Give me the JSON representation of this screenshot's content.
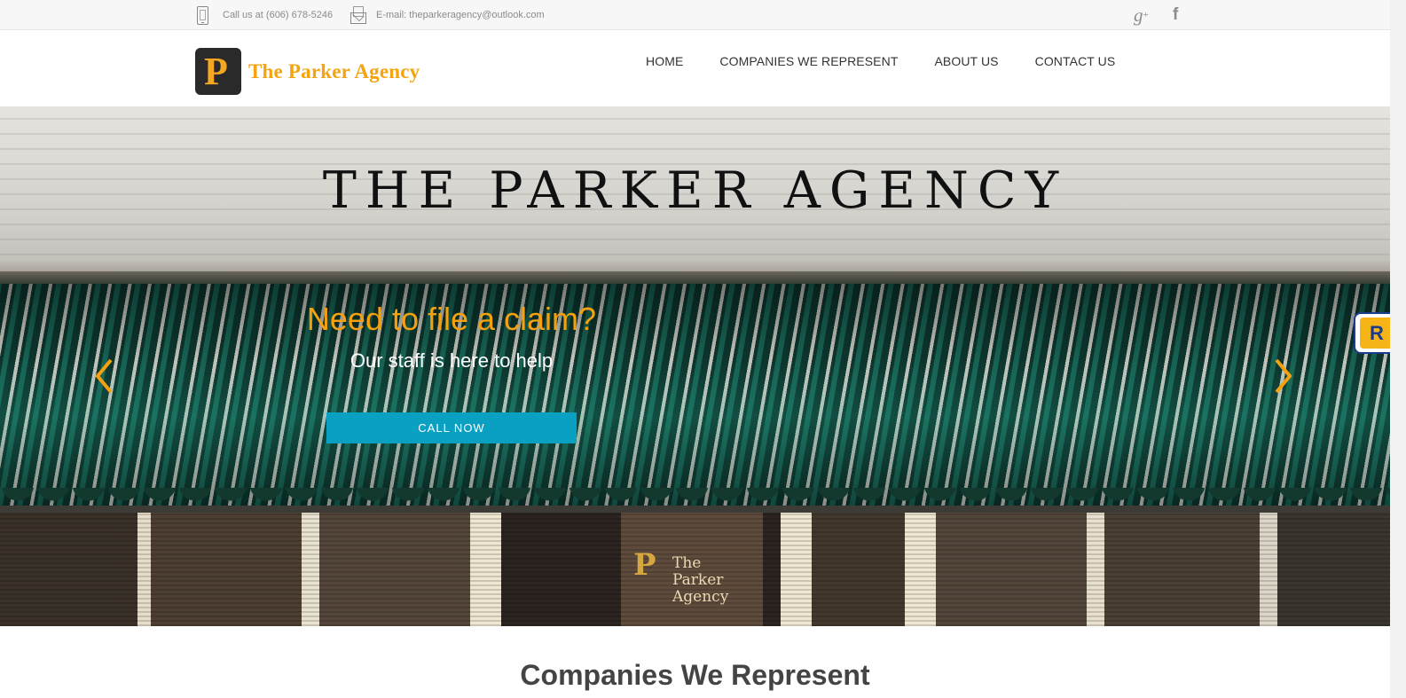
{
  "topbar": {
    "phone_text": "Call us at (606) 678-5246",
    "email_text": "E-mail: theparkeragency@outlook.com",
    "social": [
      {
        "icon": "google-plus-icon",
        "glyph": "g",
        "sup": "+"
      },
      {
        "icon": "facebook-icon",
        "glyph": "f"
      }
    ]
  },
  "header": {
    "logo_letter": "P",
    "logo_text": "The Parker Agency",
    "nav": [
      "HOME",
      "COMPANIES WE REPRESENT",
      "ABOUT US",
      "CONTACT US"
    ]
  },
  "hero": {
    "sign_text": "THE PARKER AGENCY",
    "door_sign": [
      "The",
      "Parker",
      "Agency"
    ],
    "title": "Need to file a claim?",
    "subtitle": "Our staff is here to help",
    "button_label": "CALL NOW",
    "accent_color": "#f5a00f",
    "button_color": "#0aa0c2"
  },
  "widget": {
    "letter": "R"
  },
  "section": {
    "title": "Companies We Represent"
  }
}
